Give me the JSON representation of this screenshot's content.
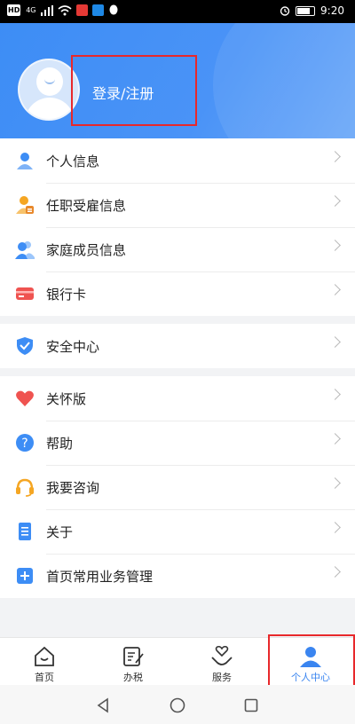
{
  "status_bar": {
    "left_badges": [
      "HD",
      "4G"
    ],
    "time": "9:20",
    "icons": [
      "wifi-icon",
      "signal-icon",
      "app-notification-icon",
      "qq-icon",
      "alarm-icon",
      "battery-icon"
    ]
  },
  "header": {
    "login_label": "登录/注册",
    "accent": "#3d8df5"
  },
  "menu": {
    "group1": [
      {
        "label": "个人信息",
        "icon": "person-icon"
      },
      {
        "label": "任职受雇信息",
        "icon": "employment-icon"
      },
      {
        "label": "家庭成员信息",
        "icon": "family-icon"
      },
      {
        "label": "银行卡",
        "icon": "bank-card-icon"
      }
    ],
    "group2": [
      {
        "label": "安全中心",
        "icon": "shield-icon"
      }
    ],
    "group3": [
      {
        "label": "关怀版",
        "icon": "heart-icon"
      },
      {
        "label": "帮助",
        "icon": "help-icon"
      },
      {
        "label": "我要咨询",
        "icon": "headset-icon"
      },
      {
        "label": "关于",
        "icon": "document-icon"
      },
      {
        "label": "首页常用业务管理",
        "icon": "plus-square-icon"
      }
    ]
  },
  "tabbar": {
    "tabs": [
      {
        "label": "首页",
        "icon": "home-icon"
      },
      {
        "label": "办税",
        "icon": "tax-form-icon"
      },
      {
        "label": "服务",
        "icon": "service-heart-icon"
      },
      {
        "label": "个人中心",
        "icon": "profile-icon"
      }
    ],
    "active_index": 3,
    "active_color": "#3a85f0"
  },
  "system_nav": [
    "back-icon",
    "home-circle-icon",
    "recents-icon"
  ]
}
